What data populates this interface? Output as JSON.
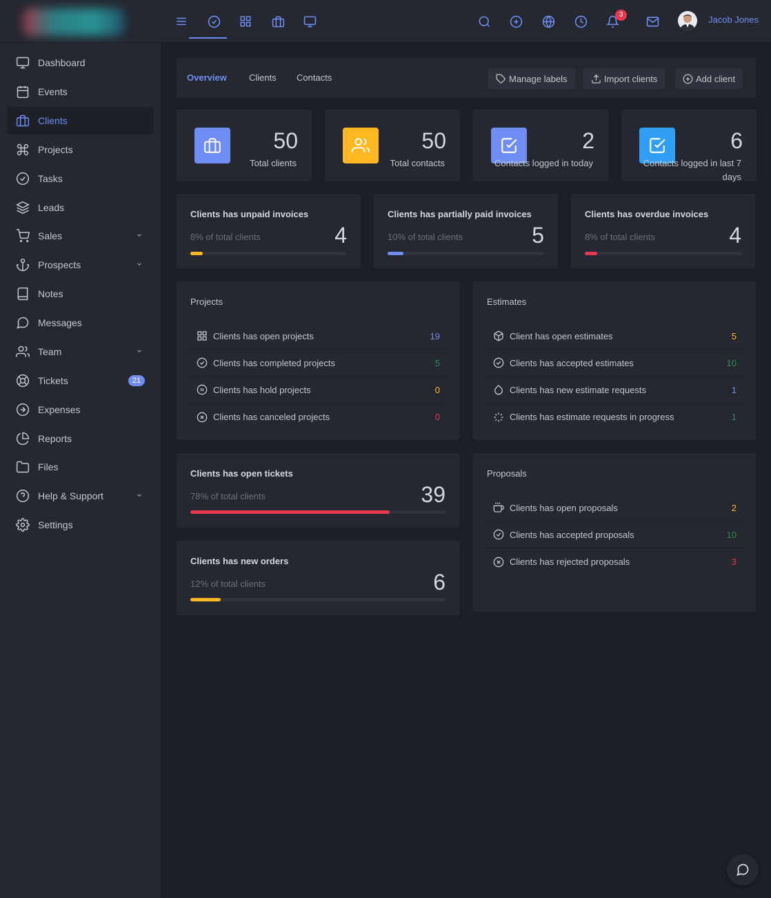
{
  "topbar": {
    "user_name": "Jacob Jones",
    "notification_count": "3",
    "icons": [
      "menu-icon",
      "checkbox-icon",
      "grid-icon",
      "briefcase-icon",
      "monitor-icon",
      "search-icon",
      "plus-circle-icon",
      "globe-icon",
      "clock-icon",
      "bell-icon",
      "mail-icon"
    ]
  },
  "sidebar": {
    "items": [
      {
        "label": "Dashboard",
        "icon": "monitor-icon"
      },
      {
        "label": "Events",
        "icon": "calendar-icon"
      },
      {
        "label": "Clients",
        "icon": "briefcase-icon",
        "active": true
      },
      {
        "label": "Projects",
        "icon": "command-icon"
      },
      {
        "label": "Tasks",
        "icon": "check-circle-icon"
      },
      {
        "label": "Leads",
        "icon": "layers-icon"
      },
      {
        "label": "Sales",
        "icon": "cart-icon",
        "expandable": true
      },
      {
        "label": "Prospects",
        "icon": "anchor-icon",
        "expandable": true
      },
      {
        "label": "Notes",
        "icon": "book-icon"
      },
      {
        "label": "Messages",
        "icon": "message-icon"
      },
      {
        "label": "Team",
        "icon": "users-icon",
        "expandable": true
      },
      {
        "label": "Tickets",
        "icon": "lifebuoy-icon",
        "badge": "21"
      },
      {
        "label": "Expenses",
        "icon": "arrow-circle-icon"
      },
      {
        "label": "Reports",
        "icon": "pie-chart-icon"
      },
      {
        "label": "Files",
        "icon": "folder-icon"
      },
      {
        "label": "Help & Support",
        "icon": "help-circle-icon",
        "expandable": true
      },
      {
        "label": "Settings",
        "icon": "settings-icon"
      }
    ]
  },
  "tabs": [
    {
      "label": "Overview",
      "active": true
    },
    {
      "label": "Clients"
    },
    {
      "label": "Contacts"
    }
  ],
  "actions": {
    "manage_labels": "Manage labels",
    "import_clients": "Import clients",
    "add_client": "Add client"
  },
  "stats": [
    {
      "value": "50",
      "label": "Total clients",
      "color": "#6f8df2",
      "icon": "briefcase-icon"
    },
    {
      "value": "50",
      "label": "Total contacts",
      "color": "#ffb822",
      "icon": "users-icon"
    },
    {
      "value": "2",
      "label": "Contacts logged in today",
      "color": "#6f8df2",
      "icon": "checkbox-icon"
    },
    {
      "value": "6",
      "label_line1": "Contacts logged in last 7",
      "label_line2": "days",
      "color": "#2f9ef4",
      "icon": "checkbox-icon"
    }
  ],
  "invoices": [
    {
      "title": "Clients has unpaid invoices",
      "subtitle": "8% of total clients",
      "value": "4",
      "percent": 8,
      "color": "#ffb822"
    },
    {
      "title": "Clients has partially paid invoices",
      "subtitle": "10% of total clients",
      "value": "5",
      "percent": 10,
      "color": "#6f8df2"
    },
    {
      "title": "Clients has overdue invoices",
      "subtitle": "8% of total clients",
      "value": "4",
      "percent": 8,
      "color": "#e8384f"
    }
  ],
  "projects": {
    "title": "Projects",
    "rows": [
      {
        "label": "Clients has open projects",
        "value": "19",
        "color": "#6f8df2",
        "icon": "grid-icon"
      },
      {
        "label": "Clients has completed projects",
        "value": "5",
        "color": "#2e8b57",
        "icon": "check-circle-icon"
      },
      {
        "label": "Clients has hold projects",
        "value": "0",
        "color": "#ffb822",
        "icon": "pause-circle-icon"
      },
      {
        "label": "Clients has canceled projects",
        "value": "0",
        "color": "#e8384f",
        "icon": "x-circle-icon"
      }
    ]
  },
  "estimates": {
    "title": "Estimates",
    "rows": [
      {
        "label": "Client has open estimates",
        "value": "5",
        "color": "#ffb822",
        "icon": "box-icon"
      },
      {
        "label": "Clients has accepted estimates",
        "value": "10",
        "color": "#2e8b57",
        "icon": "check-circle-icon"
      },
      {
        "label": "Clients has new estimate requests",
        "value": "1",
        "color": "#6f8df2",
        "icon": "droplet-icon"
      },
      {
        "label": "Clients has estimate requests in progress",
        "value": "1",
        "color": "#2e8b57",
        "icon": "loader-icon"
      }
    ]
  },
  "tickets": {
    "title": "Clients has open tickets",
    "subtitle": "78% of total clients",
    "value": "39",
    "percent": 78,
    "color": "#e8384f"
  },
  "orders": {
    "title": "Clients has new orders",
    "subtitle": "12% of total clients",
    "value": "6",
    "percent": 12,
    "color": "#ffb822"
  },
  "proposals": {
    "title": "Proposals",
    "rows": [
      {
        "label": "Clients has open proposals",
        "value": "2",
        "color": "#ffb822",
        "icon": "coffee-icon"
      },
      {
        "label": "Clients has accepted proposals",
        "value": "10",
        "color": "#2e8b57",
        "icon": "check-circle-icon"
      },
      {
        "label": "Clients has rejected proposals",
        "value": "3",
        "color": "#e8384f",
        "icon": "x-circle-icon"
      }
    ]
  }
}
